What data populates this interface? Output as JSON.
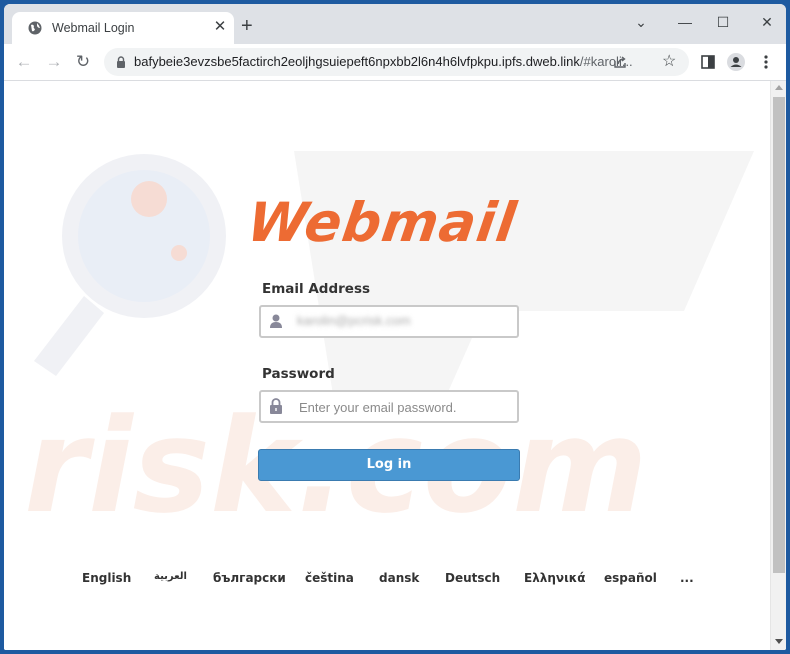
{
  "browser": {
    "tab_title": "Webmail Login",
    "new_tab_symbol": "+",
    "close_tab_symbol": "✕",
    "url_main": "bafybeie3evzsbe5factirch2eoljhgsuiepeft6npxbb2l6n4h6lvfpkpu.ipfs.dweb.link",
    "url_fragment": "/#karoli...",
    "window_controls": {
      "tab_search": "⌄",
      "minimize": "—",
      "maximize": "☐",
      "close": "✕"
    },
    "nav": {
      "back": "←",
      "forward": "→",
      "reload": "↻"
    },
    "icons": [
      "globe-icon",
      "lock-icon",
      "share-icon",
      "star-icon",
      "side-panel-icon",
      "profile-icon",
      "menu-icon"
    ]
  },
  "page": {
    "logo_text": "Webmail",
    "email_label": "Email Address",
    "email_value": "karolin@pcrisk.com",
    "password_label": "Password",
    "password_placeholder": "Enter your email password.",
    "login_button": "Log in",
    "languages": [
      "English",
      "العربية",
      "български",
      "čeština",
      "dansk",
      "Deutsch",
      "Ελληνικά",
      "español",
      "..."
    ],
    "colors": {
      "logo": "#ed6b33",
      "button": "#4a98d3"
    }
  }
}
